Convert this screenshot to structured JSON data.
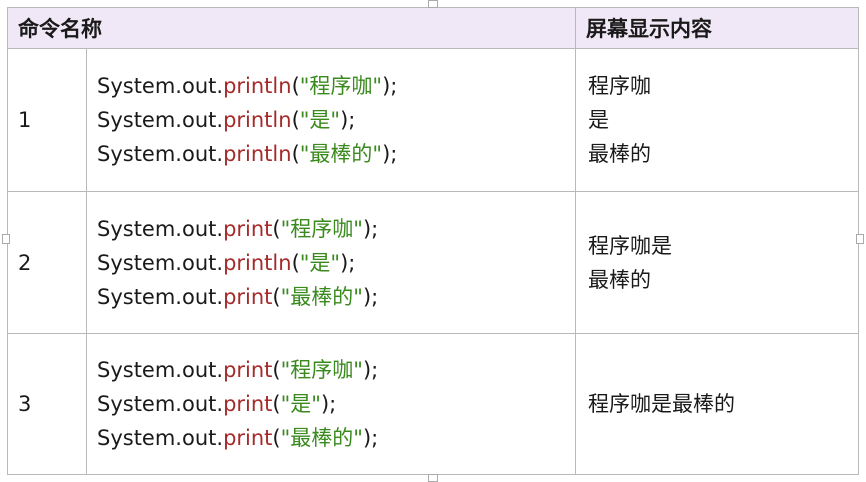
{
  "table": {
    "headers": [
      "命令名称",
      "屏幕显示内容"
    ],
    "rows": [
      {
        "num": "1",
        "code": [
          {
            "prefix": "System.out.",
            "method": "println",
            "open": "(",
            "string": "\"程序咖\"",
            "close": ");"
          },
          {
            "prefix": "System.out.",
            "method": "println",
            "open": "(",
            "string": "\"是\"",
            "close": ");"
          },
          {
            "prefix": "System.out.",
            "method": "println",
            "open": "(",
            "string": "\"最棒的\"",
            "close": ");"
          }
        ],
        "output": [
          "程序咖",
          "是",
          "最棒的"
        ]
      },
      {
        "num": "2",
        "code": [
          {
            "prefix": "System.out.",
            "method": "print",
            "open": "(",
            "string": "\"程序咖\"",
            "close": ");"
          },
          {
            "prefix": "System.out.",
            "method": "println",
            "open": "(",
            "string": "\"是\"",
            "close": ");"
          },
          {
            "prefix": "System.out.",
            "method": "print",
            "open": "(",
            "string": "\"最棒的\"",
            "close": ");"
          }
        ],
        "output": [
          "程序咖是",
          "最棒的"
        ]
      },
      {
        "num": "3",
        "code": [
          {
            "prefix": "System.out.",
            "method": "print",
            "open": "(",
            "string": "\"程序咖\"",
            "close": ");"
          },
          {
            "prefix": "System.out.",
            "method": "print",
            "open": "(",
            "string": "\"是\"",
            "close": ");"
          },
          {
            "prefix": "System.out.",
            "method": "print",
            "open": "(",
            "string": "\"最棒的\"",
            "close": ");"
          }
        ],
        "output": [
          "程序咖是最棒的"
        ]
      }
    ]
  },
  "colors": {
    "method": "#a52a2a",
    "string": "#3a8a1e",
    "header_bg": "#f1e8f7"
  }
}
